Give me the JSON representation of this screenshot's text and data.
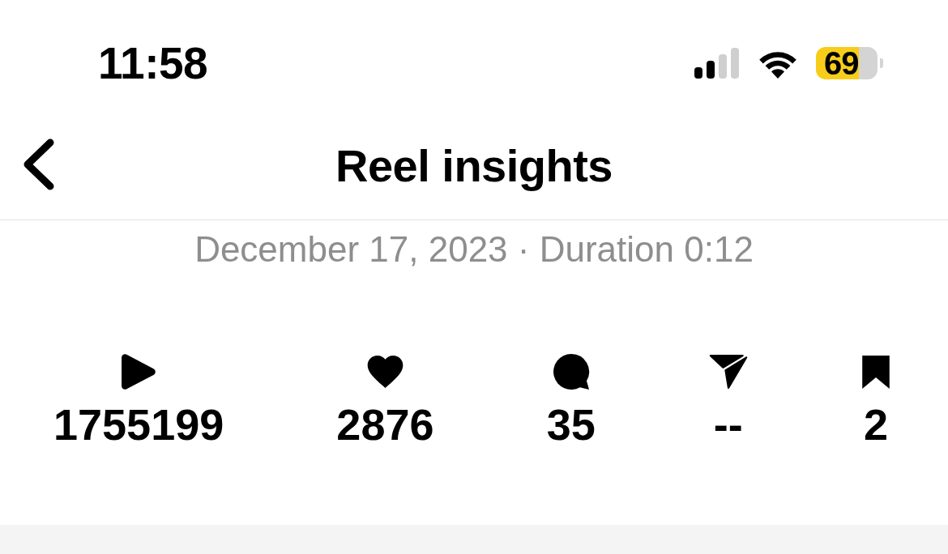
{
  "status_bar": {
    "time": "11:58",
    "battery_percent": "69"
  },
  "header": {
    "title": "Reel insights"
  },
  "summary": "December 17, 2023 · Duration 0:12",
  "metrics": [
    {
      "kind": "plays",
      "value": "1755199"
    },
    {
      "kind": "likes",
      "value": "2876"
    },
    {
      "kind": "comments",
      "value": "35"
    },
    {
      "kind": "shares",
      "value": "--"
    },
    {
      "kind": "saves",
      "value": "2"
    }
  ]
}
